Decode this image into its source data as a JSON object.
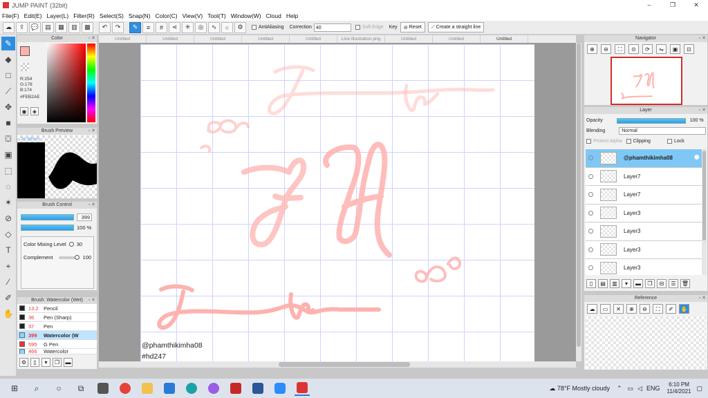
{
  "window": {
    "title": "JUMP PAINT (32bit)"
  },
  "menu": [
    "File(F)",
    "Edit(E)",
    "Layer(L)",
    "Filter(R)",
    "Select(S)",
    "Snap(N)",
    "Color(C)",
    "View(V)",
    "Tool(T)",
    "Window(W)",
    "Cloud",
    "Help"
  ],
  "toolbar": {
    "antialiasing_label": "AntiAliasing",
    "correction_label": "Correction",
    "correction_value": "40",
    "soft_edge_label": "Soft Edge",
    "key_label": "Key",
    "reset_label": "Reset",
    "straight_line_label": "Create a straight line"
  },
  "color_panel": {
    "title": "Color",
    "r": "R:254",
    "g": "G:178",
    "b": "B:174",
    "hex": "#FEB2AE",
    "current_color": "#FEB2AE"
  },
  "brush_preview": {
    "title": "Brush Preview",
    "size": "20.98mm"
  },
  "brush_control": {
    "title": "Brush Control",
    "size_value": "399",
    "opacity_value": "100 %",
    "mixing_label": "Color Mixing Level",
    "mixing_value": "30",
    "complement_label": "Complement",
    "complement_value": "100"
  },
  "brush_list": {
    "title": "Brush: Watercolor (Wet)",
    "items": [
      {
        "size": "13.2",
        "name": "Pencil",
        "color": "#222222"
      },
      {
        "size": "36",
        "name": "Pen (Sharp)",
        "color": "#222222"
      },
      {
        "size": "37",
        "name": "Pen",
        "color": "#222222"
      },
      {
        "size": "399",
        "name": "Watercolor (W",
        "color": "#8fd0ff"
      },
      {
        "size": "595",
        "name": "G Pen",
        "color": "#e33333"
      },
      {
        "size": "466",
        "name": "Watercolor",
        "color": "#8fd0ff"
      }
    ]
  },
  "tabs": [
    "Untitled",
    "Untitled",
    "Untitled",
    "Untitled",
    "Untitled",
    "Line Illustration.png",
    "Untitled",
    "Untitled",
    "Untitled"
  ],
  "canvas": {
    "watermark_user": "@phamthikimha08",
    "watermark_tag": "#hd247",
    "stroke_color": "#FEB2AE"
  },
  "navigator": {
    "title": "Navigator"
  },
  "layer_panel": {
    "title": "Layer",
    "opacity_label": "Opacity",
    "opacity_value": "100 %",
    "blending_label": "Blending",
    "blending_value": "Normal",
    "protect_alpha_label": "Protect Alpha",
    "clipping_label": "Clipping",
    "lock_label": "Lock",
    "layers": [
      "@phamthikimha08",
      "Layer7",
      "Layer7",
      "Layer3",
      "Layer3",
      "Layer3",
      "Layer3"
    ]
  },
  "reference": {
    "title": "Reference"
  },
  "taskbar": {
    "weather": "78°F  Mostly cloudy",
    "lang": "ENG",
    "time": "6:10 PM",
    "date": "11/4/2021"
  }
}
